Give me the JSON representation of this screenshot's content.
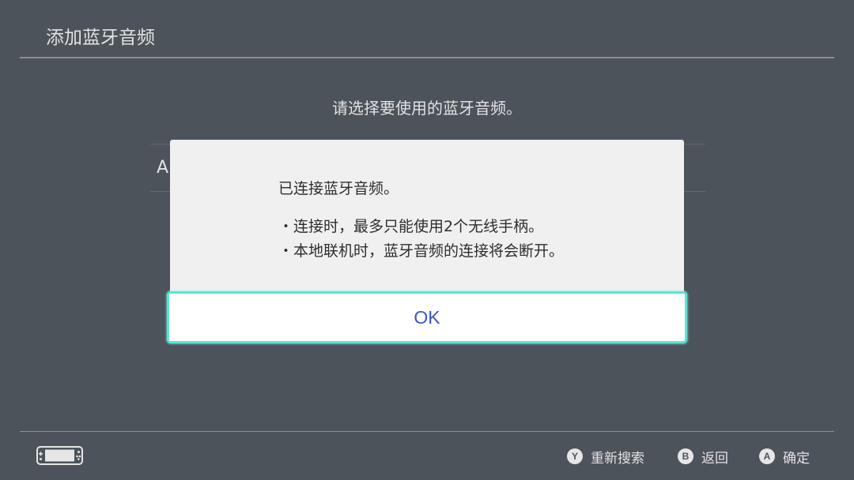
{
  "header": {
    "title": "添加蓝牙音频"
  },
  "main": {
    "instruction": "请选择要使用的蓝牙音频。",
    "list_item_partial": "A"
  },
  "dialog": {
    "message": "已连接蓝牙音频。",
    "bullets": [
      "・连接时，最多只能使用2个无线手柄。",
      "・本地联机时，蓝牙音频的连接将会断开。"
    ],
    "ok_label": "OK"
  },
  "footer": {
    "console_icon": "handheld-console-icon",
    "hints": [
      {
        "button": "Y",
        "icon": "y-button-icon",
        "label": "重新搜索"
      },
      {
        "button": "B",
        "icon": "b-button-icon",
        "label": "返回"
      },
      {
        "button": "A",
        "icon": "a-button-icon",
        "label": "确定"
      }
    ]
  },
  "colors": {
    "background": "#4d535b",
    "dialog_background": "#f0f0f0",
    "focus_border": "#5ae6d2",
    "ok_text": "#3d54c8"
  }
}
